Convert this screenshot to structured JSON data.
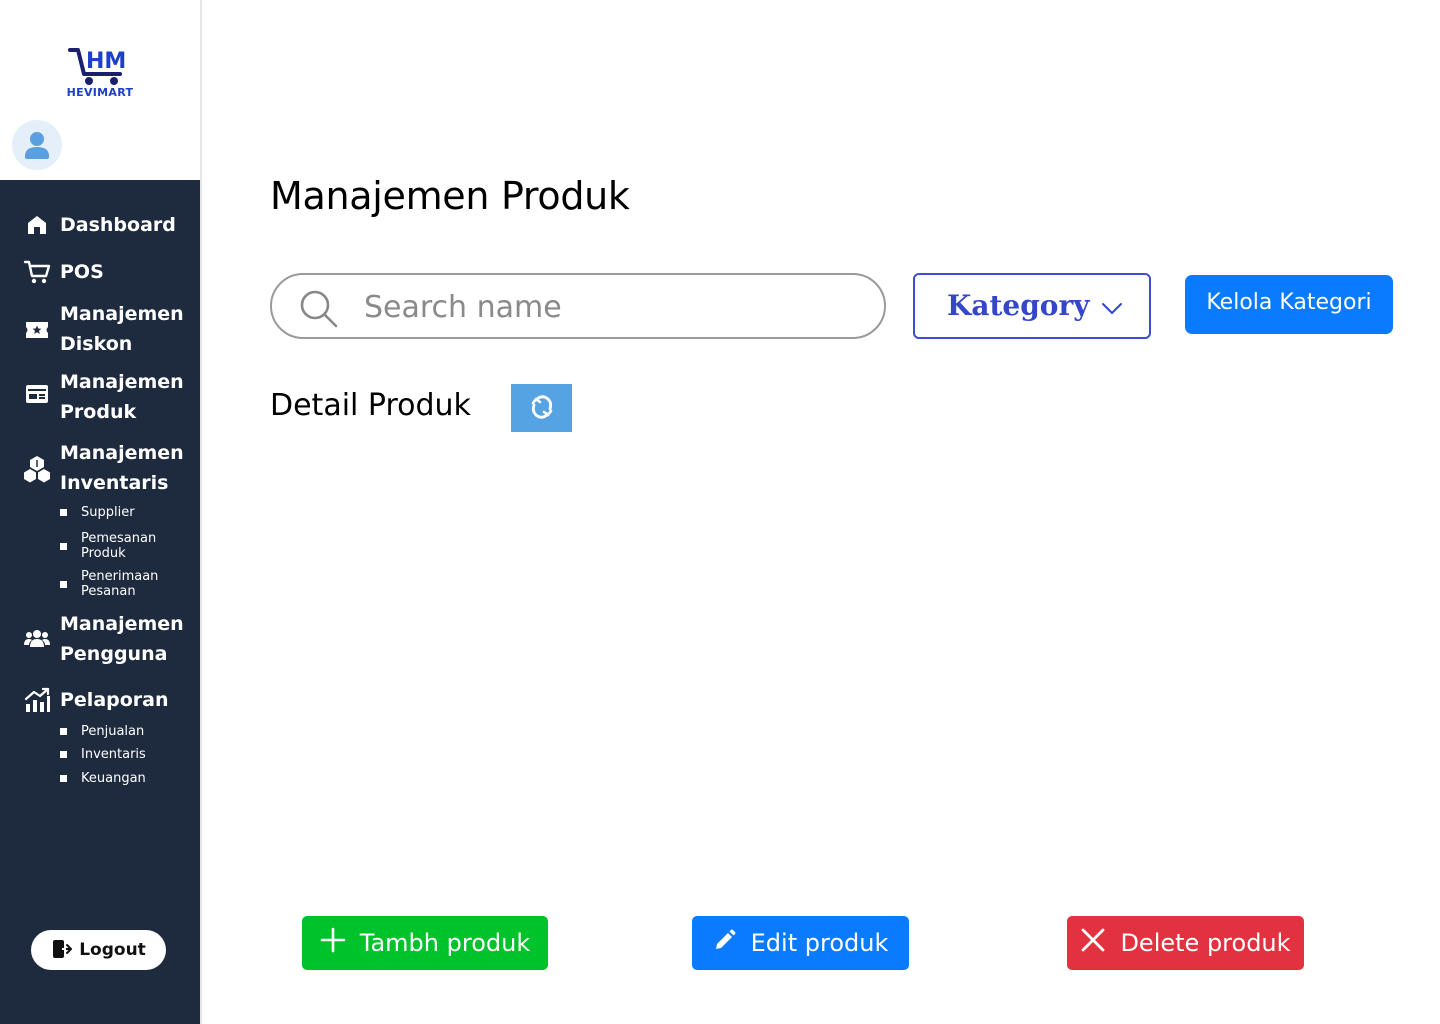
{
  "brand": {
    "logo_text": "HEVIMART"
  },
  "sidebar": {
    "items": [
      {
        "label": "Dashboard",
        "icon": "home-icon"
      },
      {
        "label": "POS",
        "icon": "cart-icon"
      },
      {
        "label": "Manajemen Diskon",
        "icon": "ticket-icon"
      },
      {
        "label": "Manajemen Produk",
        "icon": "product-card-icon"
      },
      {
        "label": "Manajemen Inventaris",
        "icon": "boxes-icon"
      },
      {
        "label": "Manajemen Pengguna",
        "icon": "users-icon"
      },
      {
        "label": "Pelaporan",
        "icon": "chart-icon"
      }
    ],
    "inventaris_sub": [
      "Supplier",
      "Pemesanan Produk",
      "Penerimaan Pesanan"
    ],
    "pelaporan_sub": [
      "Penjualan",
      "Inventaris",
      "Keuangan"
    ],
    "logout_label": "Logout"
  },
  "main": {
    "title": "Manajemen Produk",
    "search": {
      "placeholder": "Search name",
      "value": ""
    },
    "category_dropdown": {
      "selected": "Kategory"
    },
    "kelola_label": "Kelola Kategori",
    "detail_title": "Detail Produk",
    "actions": {
      "add": "Tambh produk",
      "edit": "Edit produk",
      "delete": "Delete produk"
    }
  },
  "colors": {
    "sidebar_bg": "#1e2a3e",
    "primary": "#0a7bff",
    "success": "#00c22b",
    "danger": "#e2313f",
    "dropdown_border": "#3b4fd0",
    "refresh_bg": "#56a3e3"
  }
}
